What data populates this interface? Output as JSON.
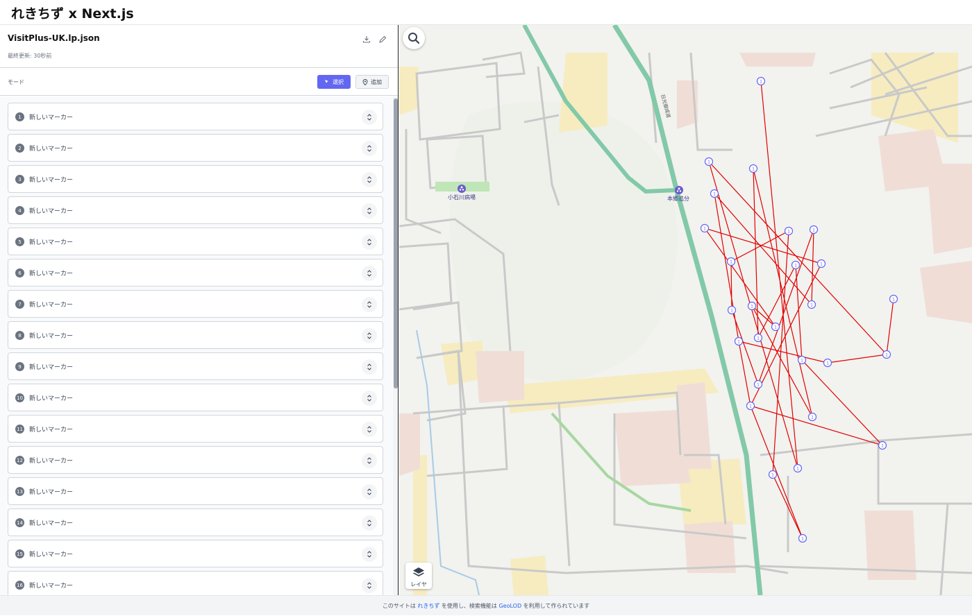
{
  "app": {
    "title": "れきちず x Next.js"
  },
  "file": {
    "name": "VisitPlus-UK.lp.json",
    "last_updated": "最終更新: 30秒前"
  },
  "mode": {
    "label": "モード",
    "select_label": "選択",
    "add_label": "追加"
  },
  "markers": [
    {
      "num": "1",
      "name": "新しいマーカー"
    },
    {
      "num": "2",
      "name": "新しいマーカー"
    },
    {
      "num": "3",
      "name": "新しいマーカー"
    },
    {
      "num": "4",
      "name": "新しいマーカー"
    },
    {
      "num": "5",
      "name": "新しいマーカー"
    },
    {
      "num": "6",
      "name": "新しいマーカー"
    },
    {
      "num": "7",
      "name": "新しいマーカー"
    },
    {
      "num": "8",
      "name": "新しいマーカー"
    },
    {
      "num": "9",
      "name": "新しいマーカー"
    },
    {
      "num": "10",
      "name": "新しいマーカー"
    },
    {
      "num": "11",
      "name": "新しいマーカー"
    },
    {
      "num": "12",
      "name": "新しいマーカー"
    },
    {
      "num": "13",
      "name": "新しいマーカー"
    },
    {
      "num": "14",
      "name": "新しいマーカー"
    },
    {
      "num": "15",
      "name": "新しいマーカー"
    },
    {
      "num": "16",
      "name": "新しいマーカー"
    }
  ],
  "map": {
    "poi_labels": [
      "小石川病場",
      "本郷追分"
    ],
    "road_label": "日光御成道",
    "marker_glyph": "1",
    "layer_label": "レイヤ",
    "route_color": "#e00000",
    "accent_color": "#6366f1"
  },
  "footer": {
    "prefix": "このサイトは ",
    "link1": "れきちず",
    "mid": " を使用し、検索機能は ",
    "link2": "GeoLOD",
    "suffix": " を利用して作られています"
  }
}
